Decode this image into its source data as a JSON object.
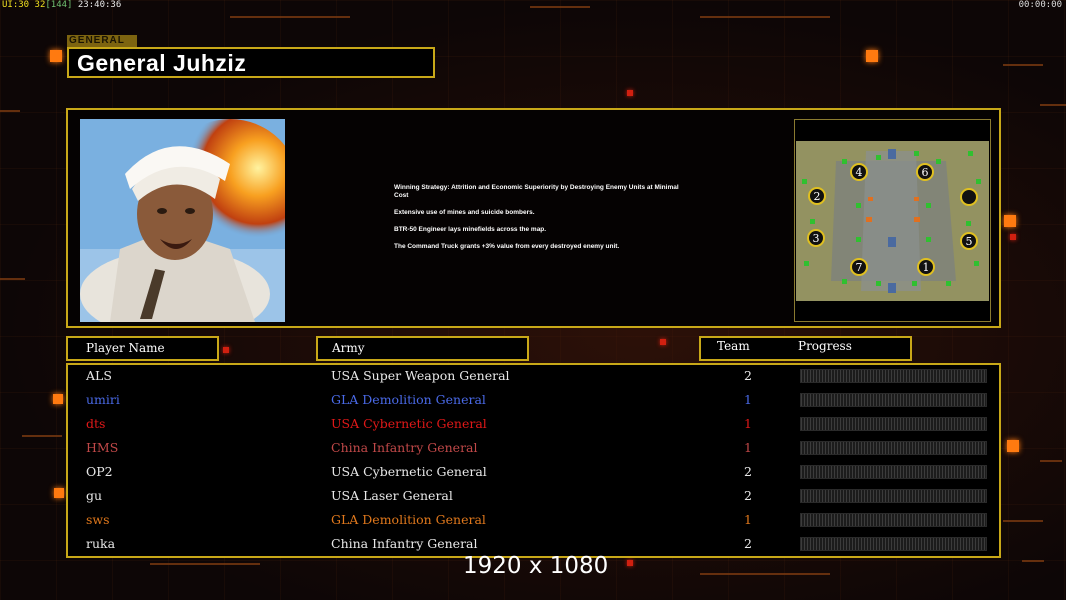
{
  "topbar": {
    "ui_version": "UI:",
    "fps": "30",
    "fps_limit": "32",
    "frame": "[144]",
    "clock": "23:40:36",
    "timer": "00:00:00"
  },
  "header": {
    "tag": "GENERAL",
    "title": "General Juhziz"
  },
  "strategy": [
    "Winning Strategy: Attrition and Economic Superiority by Destroying Enemy Units at Minimal Cost",
    "Extensive use of mines and suicide bombers.",
    "BTR-50 Engineer lays minefields across the map.",
    "The Command Truck grants +3% value from every destroyed enemy unit."
  ],
  "minimap": {
    "slots": [
      "4",
      "6",
      "2",
      "3",
      "5",
      "7",
      "1"
    ]
  },
  "table": {
    "headers": {
      "player": "Player Name",
      "army": "Army",
      "team": "Team",
      "progress": "Progress"
    },
    "rows": [
      {
        "name": "ALS",
        "army": "USA Super Weapon General",
        "team": "2",
        "color": "#e8e8e8"
      },
      {
        "name": "umiri",
        "army": "GLA Demolition General",
        "team": "1",
        "color": "#4a6ae8"
      },
      {
        "name": "dts",
        "army": "USA Cybernetic General",
        "team": "1",
        "color": "#e01818"
      },
      {
        "name": "HMS",
        "army": "China Infantry General",
        "team": "1",
        "color": "#c04848"
      },
      {
        "name": "OP2",
        "army": "USA Cybernetic General",
        "team": "2",
        "color": "#e8e8e8"
      },
      {
        "name": "gu",
        "army": "USA Laser General",
        "team": "2",
        "color": "#e8e8e8"
      },
      {
        "name": "sws",
        "army": "GLA Demolition General",
        "team": "1",
        "color": "#e0781c"
      },
      {
        "name": "ruka",
        "army": "China Infantry General",
        "team": "2",
        "color": "#e8e8e8"
      }
    ]
  },
  "resolution": "1920 x 1080",
  "colors": {
    "accent_border": "#c8a818",
    "background": "#0d0606"
  }
}
